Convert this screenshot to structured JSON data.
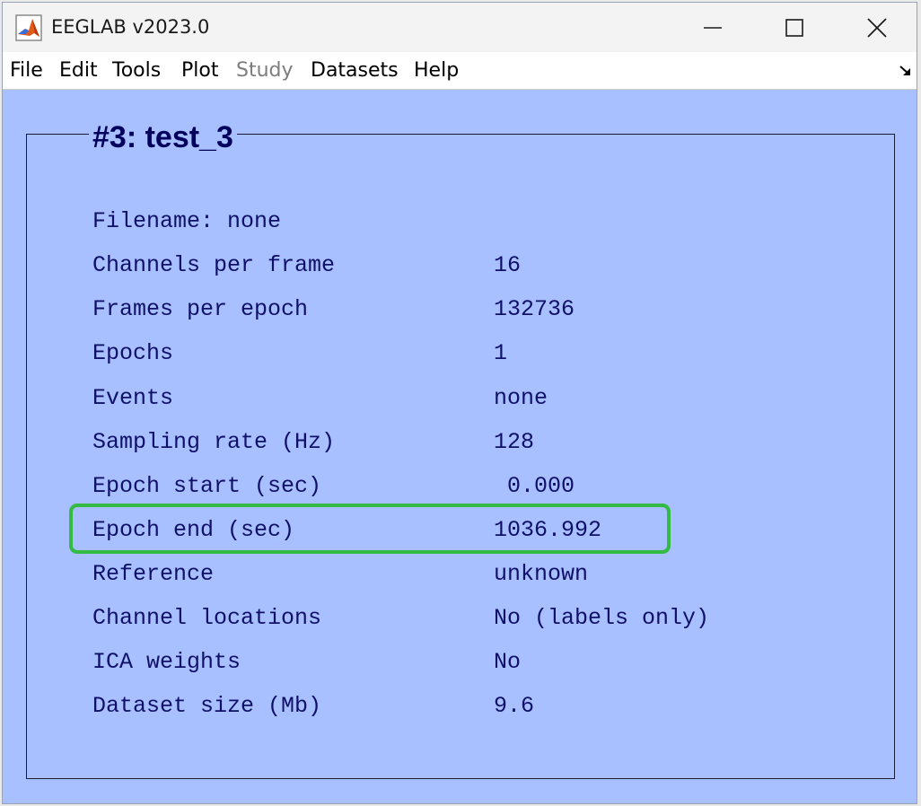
{
  "window": {
    "title": "EEGLAB v2023.0",
    "icon": "matlab-icon",
    "controls": {
      "minimize_icon": "minimize-icon",
      "maximize_icon": "maximize-icon",
      "close_icon": "close-icon"
    }
  },
  "menubar": {
    "items": [
      {
        "label": "File",
        "enabled": true
      },
      {
        "label": "Edit",
        "enabled": true
      },
      {
        "label": "Tools",
        "enabled": true
      },
      {
        "label": "Plot",
        "enabled": true
      },
      {
        "label": "Study",
        "enabled": false
      },
      {
        "label": "Datasets",
        "enabled": true
      },
      {
        "label": "Help",
        "enabled": true
      }
    ],
    "corner_icon": "corner-arrow-icon"
  },
  "panel": {
    "title": "#3: test_3",
    "rows": [
      {
        "label": "Filename: none",
        "value": ""
      },
      {
        "label": "Channels per frame",
        "value": "16"
      },
      {
        "label": "Frames per epoch",
        "value": "132736"
      },
      {
        "label": "Epochs",
        "value": "1"
      },
      {
        "label": "Events",
        "value": "none"
      },
      {
        "label": "Sampling rate (Hz)",
        "value": "128"
      },
      {
        "label": "Epoch start (sec)",
        "value": " 0.000"
      },
      {
        "label": "Epoch end (sec)",
        "value": "1036.992"
      },
      {
        "label": "Reference",
        "value": "unknown"
      },
      {
        "label": "Channel locations",
        "value": "No (labels only)"
      },
      {
        "label": "ICA weights",
        "value": "No"
      },
      {
        "label": "Dataset size (Mb)",
        "value": "9.6"
      }
    ],
    "highlighted_row": "Epoch end (sec)"
  },
  "colors": {
    "background": "#a8c0ff",
    "text": "#10106a",
    "title_text": "#00005c",
    "highlight": "#33bb44",
    "disabled_menu": "#7d7d7d"
  }
}
